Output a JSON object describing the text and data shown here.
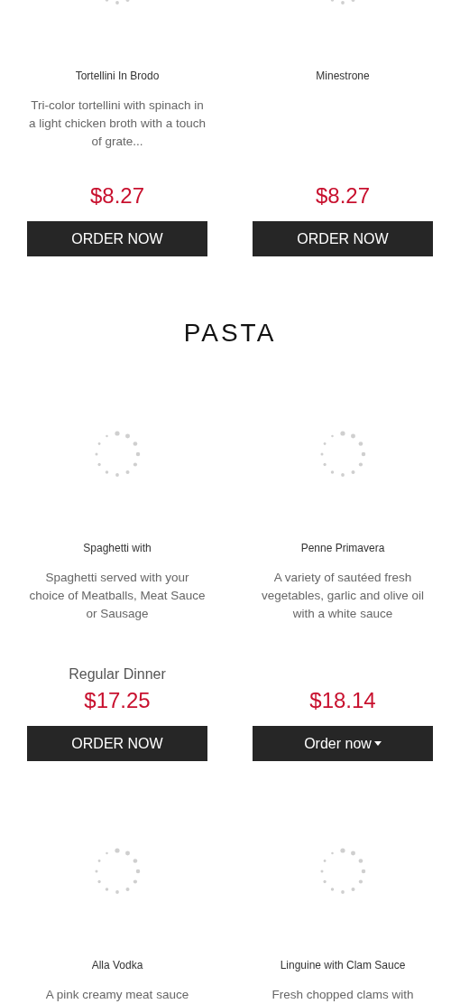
{
  "sections": [
    {
      "items": [
        {
          "name": "Tortellini In Brodo",
          "description": "Tri-color tortellini with spinach in a light chicken broth with a touch of grate...",
          "price": "$8.27",
          "button": {
            "kind": "order",
            "label": "ORDER NOW"
          }
        },
        {
          "name": "Minestrone",
          "price": "$8.27",
          "button": {
            "kind": "order",
            "label": "ORDER NOW"
          }
        }
      ]
    },
    {
      "heading": "PASTA",
      "items": [
        {
          "name": "Spaghetti with",
          "description": "Spaghetti served with your choice of Meatballs, Meat Sauce or Sausage",
          "variant": "Regular Dinner",
          "price": "$17.25",
          "button": {
            "kind": "order",
            "label": "ORDER NOW"
          }
        },
        {
          "name": "Penne Primavera",
          "description": "A variety of sautéed fresh vegetables, garlic and olive oil with a white sauce",
          "price": "$18.14",
          "button": {
            "kind": "dropdown",
            "label": "Order now"
          }
        },
        {
          "name": "Alla Vodka",
          "description": "A pink creamy meat sauce"
        },
        {
          "name": "Linguine with Clam Sauce",
          "description": "Fresh chopped clams with"
        }
      ]
    }
  ]
}
